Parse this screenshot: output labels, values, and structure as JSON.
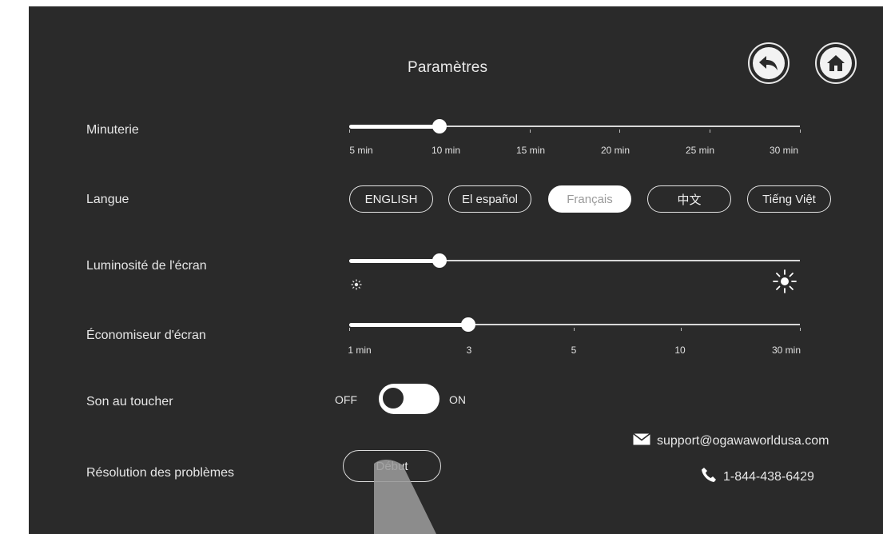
{
  "header": {
    "title": "Paramètres",
    "back_icon": "back-arrow-icon",
    "home_icon": "home-icon"
  },
  "timer": {
    "label": "Minuterie",
    "ticks": [
      "5 min",
      "10 min",
      "15 min",
      "20 min",
      "25 min",
      "30 min"
    ],
    "value": "10 min"
  },
  "language": {
    "label": "Langue",
    "options": [
      "ENGLISH",
      "El español",
      "Français",
      "中文",
      "Tiếng Việt"
    ],
    "selected": "Français"
  },
  "brightness": {
    "label": "Luminosité de l'écran",
    "level": 0.2,
    "low_icon": "dim-sun-icon",
    "high_icon": "bright-sun-icon"
  },
  "screensaver": {
    "label": "Économiseur d'écran",
    "ticks": [
      "1 min",
      "3",
      "5",
      "10",
      "30 min"
    ],
    "value": "3"
  },
  "touch_sound": {
    "label": "Son au toucher",
    "off_label": "OFF",
    "on_label": "ON",
    "state": "on"
  },
  "troubleshooting": {
    "label": "Résolution des problèmes",
    "button_label": "Début"
  },
  "contact": {
    "email": "support@ogawaworldusa.com",
    "phone": "1-844-438-6429",
    "email_icon": "envelope-icon",
    "phone_icon": "phone-icon"
  },
  "colors": {
    "background": "#2a2a2a",
    "foreground": "#ffffff",
    "page": "#ffffff"
  }
}
